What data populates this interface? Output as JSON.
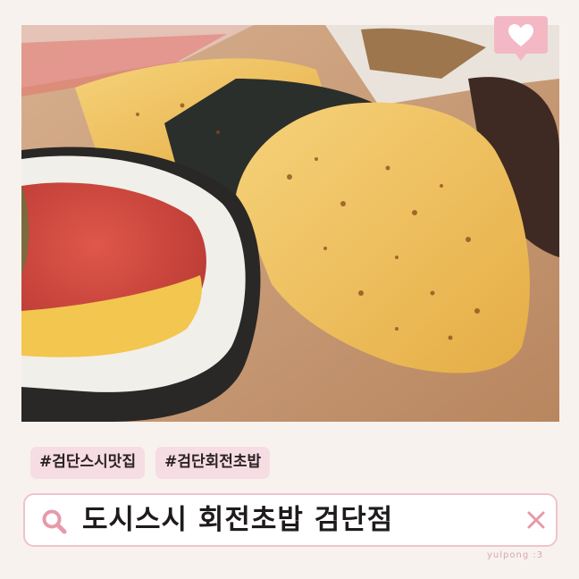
{
  "tags": [
    "#검단스시맛집",
    "#검단회전초밥"
  ],
  "search": {
    "value": "도시스시 회전초밥 검단점"
  },
  "watermark": "yulpong :3",
  "colors": {
    "accent_pink": "#efc3ce",
    "tag_bg": "#f6dde3",
    "badge_pink": "#f3b8c4"
  },
  "icons": {
    "search": "search-icon",
    "close": "close-icon",
    "heart": "heart-icon"
  }
}
